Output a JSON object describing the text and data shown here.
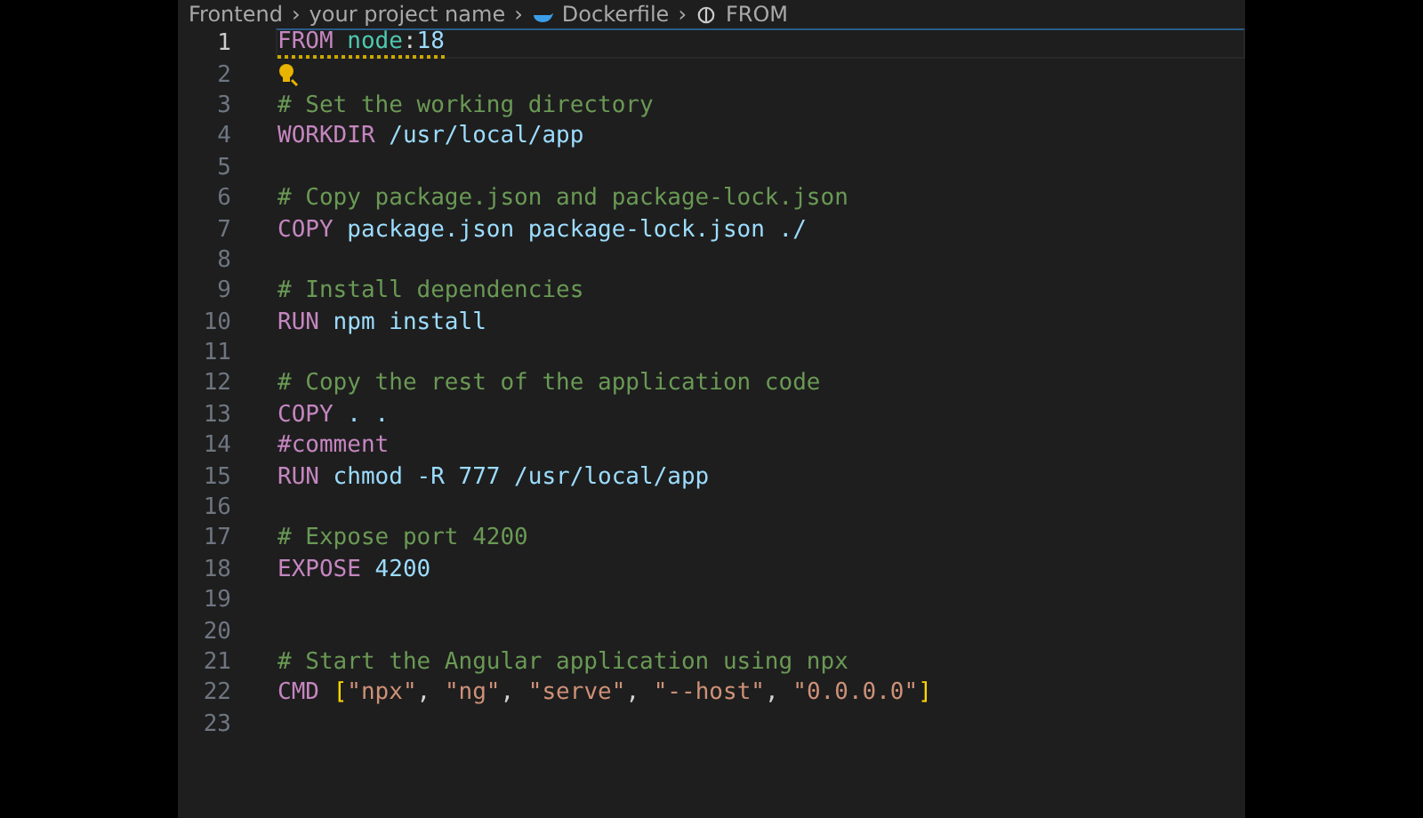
{
  "breadcrumb": [
    {
      "label": "Frontend"
    },
    {
      "separator": "›",
      "label": "your project name"
    },
    {
      "separator": "›",
      "label": "Dockerfile"
    },
    {
      "separator": "›",
      "label": "FROM"
    }
  ],
  "lines": [
    {
      "number": "1",
      "current": true,
      "warning": true,
      "tokens": [
        {
          "kind": "keyword",
          "text": "FROM "
        },
        {
          "kind": "image",
          "text": "node"
        },
        {
          "kind": "plain",
          "text": ":"
        },
        {
          "kind": "text",
          "text": "18"
        }
      ]
    },
    {
      "number": "2",
      "current": false,
      "lightbulb": true
    },
    {
      "number": "3",
      "current": false,
      "tokens": [
        {
          "kind": "comment",
          "text": "# Set the working directory"
        }
      ]
    },
    {
      "number": "4",
      "current": false,
      "tokens": [
        {
          "kind": "keyword",
          "text": "WORKDIR"
        },
        {
          "kind": "text",
          "text": " /usr/local/app"
        }
      ]
    },
    {
      "number": "5",
      "current": false
    },
    {
      "number": "6",
      "current": false,
      "tokens": [
        {
          "kind": "comment",
          "text": "# Copy package.json and package-lock.json"
        }
      ]
    },
    {
      "number": "7",
      "current": false,
      "tokens": [
        {
          "kind": "keyword",
          "text": "COPY"
        },
        {
          "kind": "text",
          "text": " package.json package-lock.json ./"
        }
      ]
    },
    {
      "number": "8",
      "current": false
    },
    {
      "number": "9",
      "current": false,
      "tokens": [
        {
          "kind": "comment",
          "text": "# Install dependencies"
        }
      ]
    },
    {
      "number": "10",
      "current": false,
      "tokens": [
        {
          "kind": "keyword",
          "text": "RUN"
        },
        {
          "kind": "text",
          "text": " npm install"
        }
      ]
    },
    {
      "number": "11",
      "current": false
    },
    {
      "number": "12",
      "current": false,
      "tokens": [
        {
          "kind": "comment",
          "text": "# Copy the rest of the application code"
        }
      ]
    },
    {
      "number": "13",
      "current": false,
      "tokens": [
        {
          "kind": "keyword",
          "text": "COPY"
        },
        {
          "kind": "text",
          "text": " . ."
        }
      ]
    },
    {
      "number": "14",
      "current": false,
      "tokens": [
        {
          "kind": "keyword",
          "text": "#comment"
        }
      ]
    },
    {
      "number": "15",
      "current": false,
      "tokens": [
        {
          "kind": "keyword",
          "text": "RUN"
        },
        {
          "kind": "text",
          "text": " chmod -R 777 /usr/local/app"
        }
      ]
    },
    {
      "number": "16",
      "current": false
    },
    {
      "number": "17",
      "current": false,
      "tokens": [
        {
          "kind": "comment",
          "text": "# Expose port 4200"
        }
      ]
    },
    {
      "number": "18",
      "current": false,
      "tokens": [
        {
          "kind": "keyword",
          "text": "EXPOSE "
        },
        {
          "kind": "text",
          "text": "4200"
        }
      ]
    },
    {
      "number": "19",
      "current": false
    },
    {
      "number": "20",
      "current": false
    },
    {
      "number": "21",
      "current": false,
      "tokens": [
        {
          "kind": "comment",
          "text": "# Start the Angular application using npx"
        }
      ]
    },
    {
      "number": "22",
      "current": false,
      "tokens": [
        {
          "kind": "keyword",
          "text": "CMD "
        },
        {
          "kind": "bracket",
          "text": "["
        },
        {
          "kind": "string",
          "text": "\"npx\""
        },
        {
          "kind": "plain",
          "text": ", "
        },
        {
          "kind": "string",
          "text": "\"ng\""
        },
        {
          "kind": "plain",
          "text": ", "
        },
        {
          "kind": "string",
          "text": "\"serve\""
        },
        {
          "kind": "plain",
          "text": ", "
        },
        {
          "kind": "string",
          "text": "\"--host\""
        },
        {
          "kind": "plain",
          "text": ", "
        },
        {
          "kind": "string",
          "text": "\"0.0.0.0\""
        },
        {
          "kind": "bracket",
          "text": "]"
        }
      ]
    },
    {
      "number": "23",
      "current": false
    }
  ]
}
